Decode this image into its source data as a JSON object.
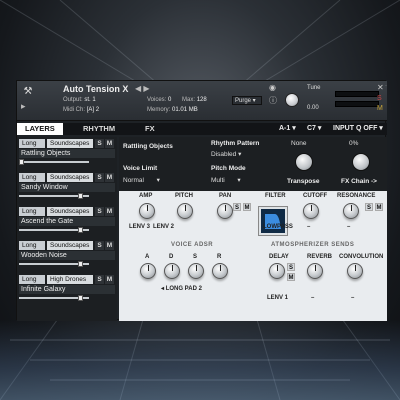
{
  "header": {
    "instrument_name": "Auto Tension X",
    "nav_arrows": "◀ ▶",
    "output_label": "Output:",
    "output_value": "st. 1",
    "midi_label": "Midi Ch:",
    "midi_value": "[A] 2",
    "voices_label": "Voices:",
    "voices_value": "0",
    "max_label": "Max:",
    "max_value": "128",
    "memory_label": "Memory:",
    "memory_value": "01.01 MB",
    "purge_label": "Purge",
    "tune_label": "Tune",
    "tune_value": "0.00"
  },
  "tabs": {
    "layers": "LAYERS",
    "rhythm": "RHYTHM",
    "fx": "FX",
    "range_a": "A-1",
    "range_b": "C7",
    "input_q_label": "INPUT Q",
    "input_q_value": "OFF"
  },
  "layers": [
    {
      "length": "Long",
      "category": "Soundscapes",
      "name": "Rattling Objects",
      "level": 0.0
    },
    {
      "length": "Long",
      "category": "Soundscapes",
      "name": "Sandy Window",
      "level": 0.85
    },
    {
      "length": "Long",
      "category": "Soundscapes",
      "name": "Ascend the Gate",
      "level": 0.85
    },
    {
      "length": "Long",
      "category": "Soundscapes",
      "name": "Wooden Noise",
      "level": 0.85
    },
    {
      "length": "Long",
      "category": "High Drones",
      "name": "Infinite Galaxy",
      "level": 0.85
    }
  ],
  "layer_buttons": {
    "solo": "S",
    "mute": "M"
  },
  "main": {
    "selected_layer": "Rattling Objects",
    "rhythm_pattern_label": "Rhythm Pattern",
    "rhythm_pattern_value": "Disabled",
    "none_label": "None",
    "percent_label": "0%",
    "voice_limit_label": "Voice Limit",
    "voice_limit_value": "Normal",
    "pitch_mode_label": "Pitch Mode",
    "pitch_mode_value": "Multi",
    "transpose_label": "Transpose",
    "fx_chain_label": "FX Chain ->"
  },
  "params": {
    "amp": "AMP",
    "pitch": "PITCH",
    "pan": "PAN",
    "filter": "FILTER",
    "cutoff": "CUTOFF",
    "resonance": "RESONANCE",
    "amp_sub": "LENV 3",
    "pitch_sub": "LENV 2",
    "filter_type": "LOWPASS",
    "voice_adsr": "VOICE ADSR",
    "a": "A",
    "d": "D",
    "s": "S",
    "r": "R",
    "adsr_preset": "LONG PAD 2",
    "atmos_sends": "ATMOSPHERIZER SENDS",
    "delay": "DELAY",
    "reverb": "REVERB",
    "convolution": "CONVOLUTION",
    "delay_sub": "LENV 1",
    "dash": "–",
    "m": "M"
  },
  "colors": {
    "accent_blue": "#3b8de0",
    "panel_light": "#e9ecef",
    "panel_dark": "#1c1f22"
  }
}
